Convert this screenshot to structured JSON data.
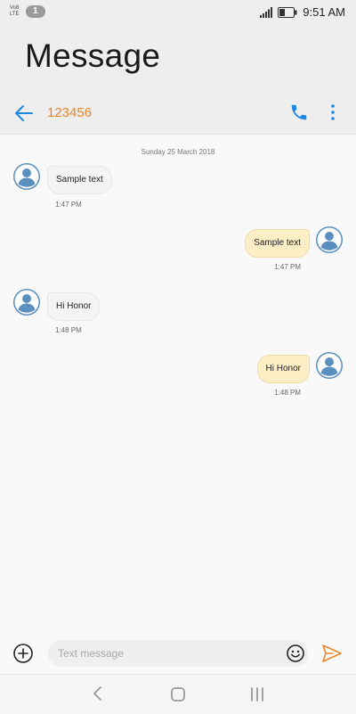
{
  "status_bar": {
    "volte_top": "Vo8",
    "volte_bottom": "LTE",
    "sim_label": "1",
    "time": "9:51 AM",
    "icons": [
      "signal-icon",
      "battery-icon"
    ]
  },
  "header": {
    "title": "Message",
    "contact": "123456",
    "icons": [
      "back-arrow-icon",
      "phone-icon",
      "more-vertical-icon"
    ],
    "accent_color": "#e8862a",
    "icon_color": "#1e88e5"
  },
  "conversation": {
    "date": "Sunday 25 March 2018",
    "messages": [
      {
        "direction": "incoming",
        "text": "Sample text",
        "time": "1:47 PM"
      },
      {
        "direction": "outgoing",
        "text": "Sample text",
        "time": "1:47 PM"
      },
      {
        "direction": "incoming",
        "text": "Hi Honor",
        "time": "1:48 PM"
      },
      {
        "direction": "outgoing",
        "text": "Hi Honor",
        "time": "1:48 PM"
      }
    ],
    "incoming_bubble_color": "#f4f4f4",
    "outgoing_bubble_color": "#fcefc6"
  },
  "composer": {
    "placeholder": "Text message",
    "value": "",
    "icons": [
      "add-circle-icon",
      "emoji-icon",
      "send-icon"
    ]
  },
  "nav_bar": {
    "icons": [
      "back-icon",
      "home-icon",
      "recent-apps-icon"
    ]
  }
}
